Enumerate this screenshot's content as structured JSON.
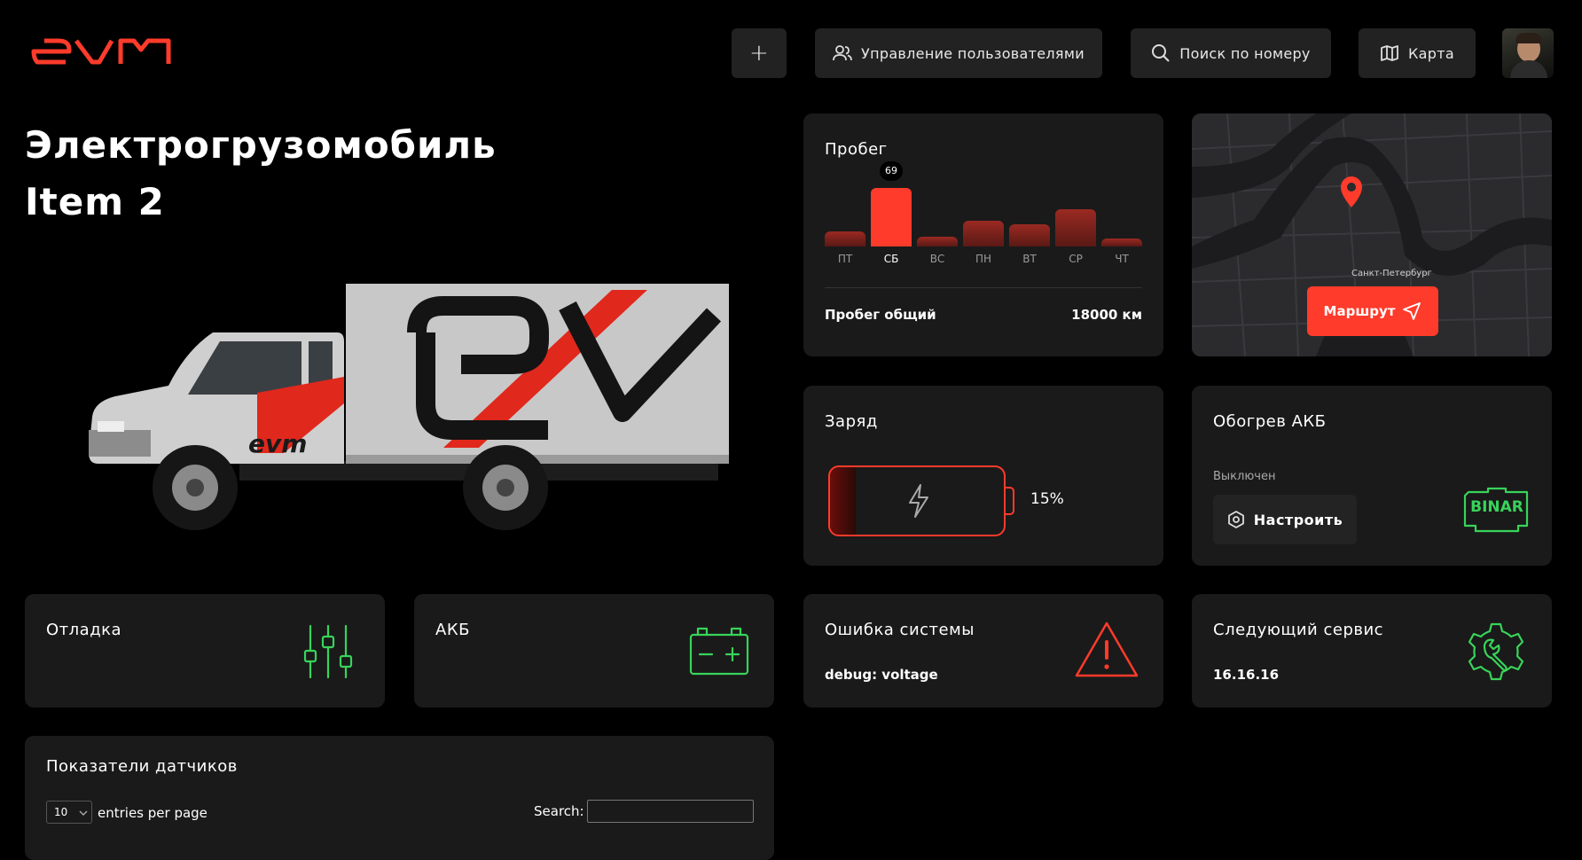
{
  "header": {
    "logo": "evm",
    "add_label": "+",
    "users_label": "Управление пользователями",
    "search_label": "Поиск по номеру",
    "map_label": "Карта"
  },
  "vehicle": {
    "title_line1": "Электрогрузомобиль",
    "title_line2": "Item 2",
    "body_logo": "ev",
    "cab_logo": "evm"
  },
  "mileage": {
    "title": "Пробег",
    "days": [
      "ПТ",
      "СБ",
      "ВС",
      "ПН",
      "ВТ",
      "СР",
      "ЧТ"
    ],
    "tooltip_value": "69",
    "total_label": "Пробег общий",
    "total_value": "18000 км"
  },
  "chart_data": {
    "type": "bar",
    "categories": [
      "ПТ",
      "СБ",
      "ВС",
      "ПН",
      "ВТ",
      "СР",
      "ЧТ"
    ],
    "values": [
      18,
      69,
      12,
      30,
      26,
      44,
      9
    ],
    "title": "Пробег",
    "highlight": "СБ",
    "ylim": [
      0,
      69
    ]
  },
  "map": {
    "city_label": "Санкт-Петербург",
    "route_label": "Маршрут"
  },
  "charge": {
    "title": "Заряд",
    "percent": "15%",
    "level": 0.15
  },
  "heating": {
    "title": "Обогрев АКБ",
    "status": "Выключен",
    "configure_label": "Настроить",
    "brand": "BINAR"
  },
  "debug": {
    "title": "Отладка"
  },
  "akb": {
    "title": "АКБ"
  },
  "error": {
    "title": "Ошибка системы",
    "message": "debug: voltage"
  },
  "service": {
    "title": "Следующий сервис",
    "date": "16.16.16"
  },
  "sensors": {
    "title": "Показатели датчиков",
    "page_size": "10",
    "entries_label": "entries per page",
    "search_label": "Search:",
    "search_value": ""
  },
  "colors": {
    "accent": "#ff3b2b",
    "green": "#38d45a",
    "card": "#1a1a1a",
    "button": "#222222"
  }
}
